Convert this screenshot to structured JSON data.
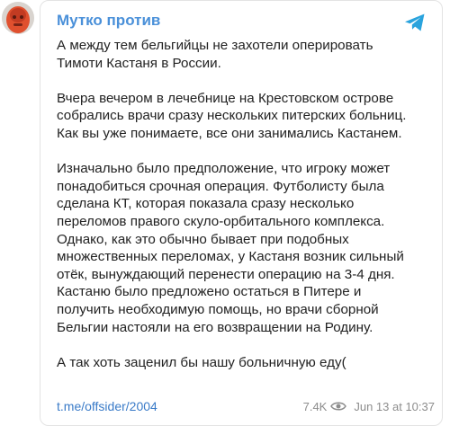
{
  "channel": {
    "name": "Мутко против",
    "avatar_icon": "channel-avatar"
  },
  "message": {
    "paragraphs": [
      [
        "А между тем бельгийцы не захотели оперировать",
        "Тимоти Кастаня в России."
      ],
      [
        "Вчера вечером в лечебнице на Крестовском острове",
        "собрались врачи сразу нескольких питерских больниц.",
        "Как вы уже понимаете, все они занимались Кастанем."
      ],
      [
        "Изначально было предположение, что игроку может",
        "понадобиться срочная операция. Футболисту была",
        "сделана КТ, которая показала сразу несколько",
        "переломов правого скуло-орбитального комплекса.",
        "Однако, как это обычно бывает при подобных",
        "множественных переломах, у Кастаня возник сильный",
        "отёк, вынуждающий перенести операцию на 3-4 дня.",
        "Кастаню было предложено остаться в Питере и",
        "получить необходимую помощь, но врачи сборной",
        "Бельгии настояли на его возвращении на Родину."
      ],
      [
        "А так хоть заценил бы нашу больничную еду("
      ]
    ]
  },
  "footer": {
    "link": "t.me/offsider/2004",
    "views": "7.4K",
    "date": "Jun 13 at 10:37",
    "eye_icon": "eye-icon"
  },
  "share_icon": "telegram-share-icon",
  "colors": {
    "accent": "#4a90d9",
    "share": "#29a3dd",
    "text": "#222222",
    "muted": "#8d8d8d"
  }
}
